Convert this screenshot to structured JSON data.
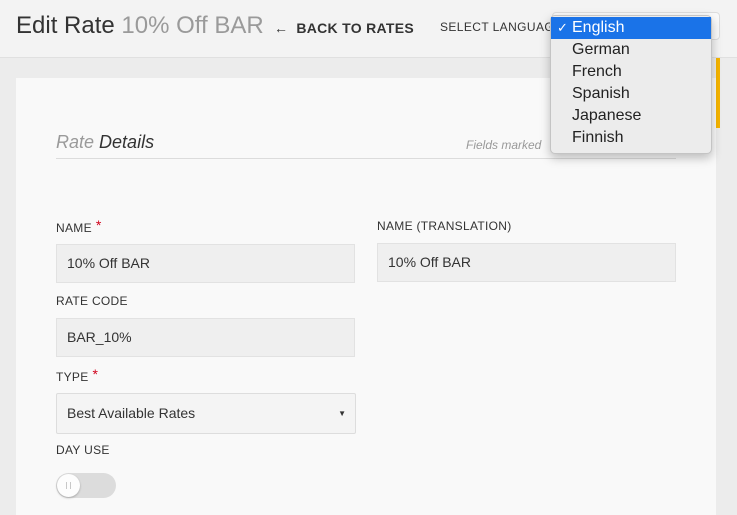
{
  "header": {
    "title": "Edit Rate",
    "subtitle": "10% Off BAR",
    "back_label": "BACK TO RATES",
    "language_label": "SELECT LANGUAGE"
  },
  "language_dropdown": {
    "selected": "English",
    "options": [
      "English",
      "German",
      "French",
      "Spanish",
      "Japanese",
      "Finnish"
    ],
    "check_glyph": "✓"
  },
  "section": {
    "title_light": "Rate",
    "title_dark": "Details",
    "note": "Fields marked"
  },
  "form": {
    "name_label": "NAME",
    "required_mark": "*",
    "name_value": "10% Off BAR",
    "name_translation_label": "NAME (TRANSLATION)",
    "name_translation_value": "10% Off BAR",
    "rate_code_label": "RATE CODE",
    "rate_code_value": "BAR_10%",
    "type_label": "TYPE",
    "type_value": "Best Available Rates",
    "day_use_label": "DAY USE",
    "day_use_enabled": false
  },
  "colors": {
    "accent": "#f5b400",
    "required": "#d0021b",
    "selection": "#1a73e8"
  }
}
